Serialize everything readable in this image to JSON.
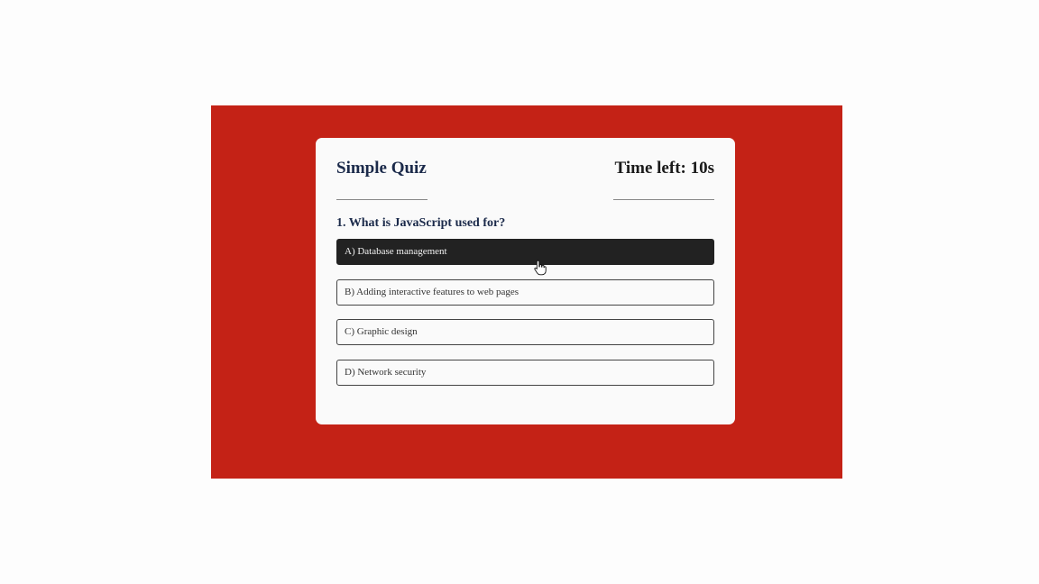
{
  "quiz": {
    "title": "Simple Quiz",
    "timer": "Time left: 10s",
    "question": "1. What is JavaScript used for?",
    "options": [
      {
        "label": "A) Database management",
        "state": "hover"
      },
      {
        "label": "B) Adding interactive features to web pages",
        "state": "default"
      },
      {
        "label": "C) Graphic design",
        "state": "default"
      },
      {
        "label": "D) Network security",
        "state": "default"
      }
    ]
  },
  "colors": {
    "background": "#c42216",
    "card": "#fafafa",
    "heading": "#1b2a4a",
    "hover_option": "#222222"
  },
  "cursor": {
    "icon": "hand-pointer-icon"
  }
}
